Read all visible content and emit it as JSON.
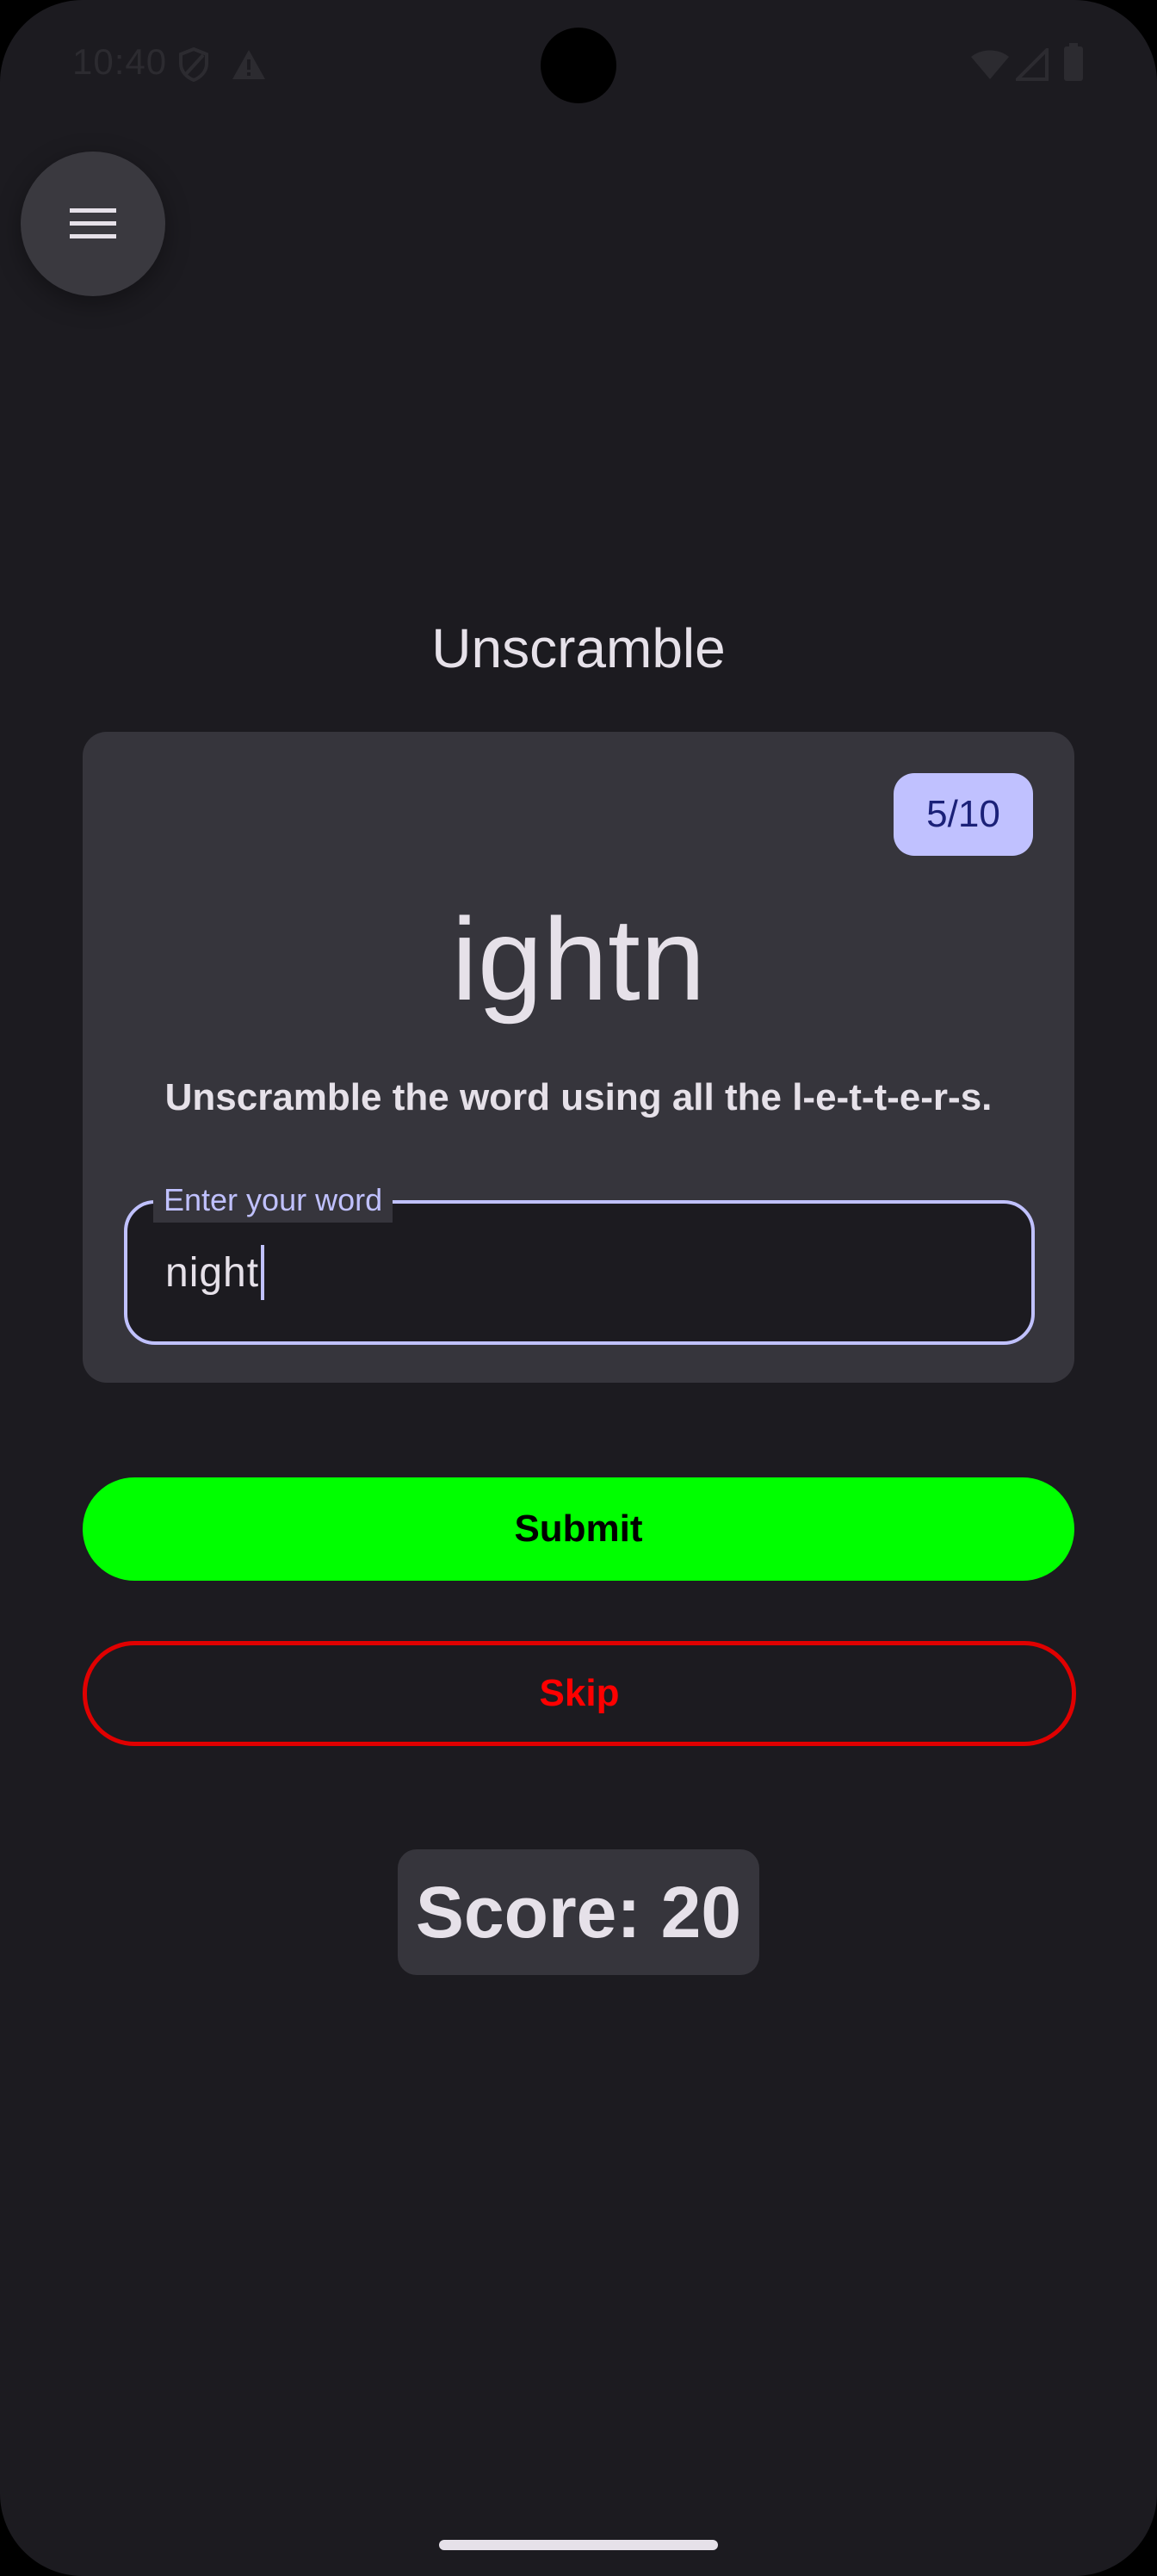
{
  "status_bar": {
    "time": "10:40",
    "icons": [
      "shield-icon",
      "alert-triangle-icon",
      "wifi-icon",
      "cell-signal-icon",
      "battery-icon"
    ]
  },
  "header": {
    "menu_icon": "hamburger-menu-icon",
    "title": "Unscramble"
  },
  "game_card": {
    "progress": "5/10",
    "scrambled_word": "ightn",
    "instructions": "Unscramble the word using all the l-e-t-t-e-r-s.",
    "input": {
      "label": "Enter your word",
      "value": "night"
    }
  },
  "actions": {
    "submit_label": "Submit",
    "skip_label": "Skip"
  },
  "score": {
    "text": "Score: 20"
  },
  "colors": {
    "background": "#1c1b20",
    "card": "#36353c",
    "accent": "#c0c1ff",
    "submit": "#00ff00",
    "skip": "#ff0000"
  }
}
